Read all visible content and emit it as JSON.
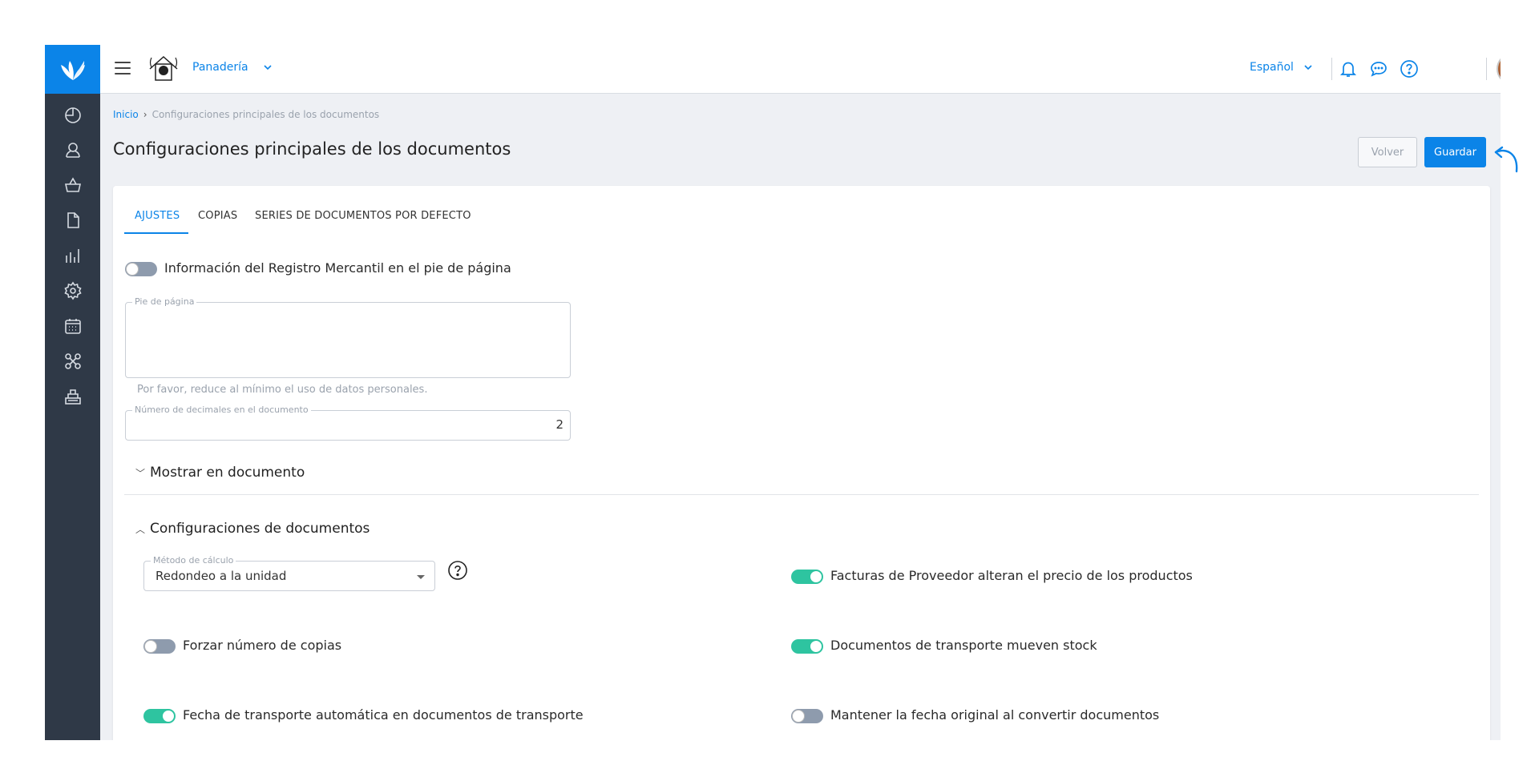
{
  "topbar": {
    "company_name": "Panadería",
    "language": "Español"
  },
  "breadcrumb": {
    "home": "Inicio",
    "current": "Configuraciones principales de los documentos"
  },
  "page": {
    "title": "Configuraciones principales de los documentos",
    "back_label": "Volver",
    "save_label": "Guardar"
  },
  "tabs": [
    {
      "label": "AJUSTES",
      "active": true
    },
    {
      "label": "COPIAS",
      "active": false
    },
    {
      "label": "SERIES DE DOCUMENTOS POR DEFECTO",
      "active": false
    }
  ],
  "settings": {
    "registro_mercantil": {
      "label": "Información del Registro Mercantil en el pie de página",
      "enabled": false
    },
    "footer": {
      "legend": "Pie de página",
      "value": "",
      "helper": "Por favor, reduce al mínimo el uso de datos personales."
    },
    "decimals": {
      "legend": "Número de decimales en el documento",
      "value": "2"
    }
  },
  "sections": {
    "mostrar": {
      "title": "Mostrar en documento",
      "expanded": false
    },
    "config": {
      "title": "Configuraciones de documentos",
      "expanded": true
    }
  },
  "config_fields": {
    "calc_method": {
      "legend": "Método de cálculo",
      "value": "Redondeo a la unidad"
    },
    "supplier_invoices": {
      "label": "Facturas de Proveedor alteran el precio de los productos",
      "enabled": true
    },
    "force_copies": {
      "label": "Forzar número de copias",
      "enabled": false
    },
    "transport_stock": {
      "label": "Documentos de transporte mueven stock",
      "enabled": true
    },
    "auto_transport_date": {
      "label": "Fecha de transporte automática en documentos de transporte",
      "enabled": true
    },
    "keep_original_date": {
      "label": "Mantener la fecha original al convertir documentos",
      "enabled": false
    }
  },
  "colors": {
    "primary": "#0b84e8",
    "sidebar": "#2f3947",
    "toggle_on": "#2ec4a0",
    "toggle_off": "#8e9bad"
  },
  "icons": {
    "sidebar": [
      "dashboard-icon",
      "user-icon",
      "basket-icon",
      "document-icon",
      "chart-icon",
      "gear-icon",
      "calendar-icon",
      "integrations-icon",
      "pos-icon"
    ],
    "topbar": [
      "bell-icon",
      "chat-icon",
      "help-icon"
    ]
  }
}
